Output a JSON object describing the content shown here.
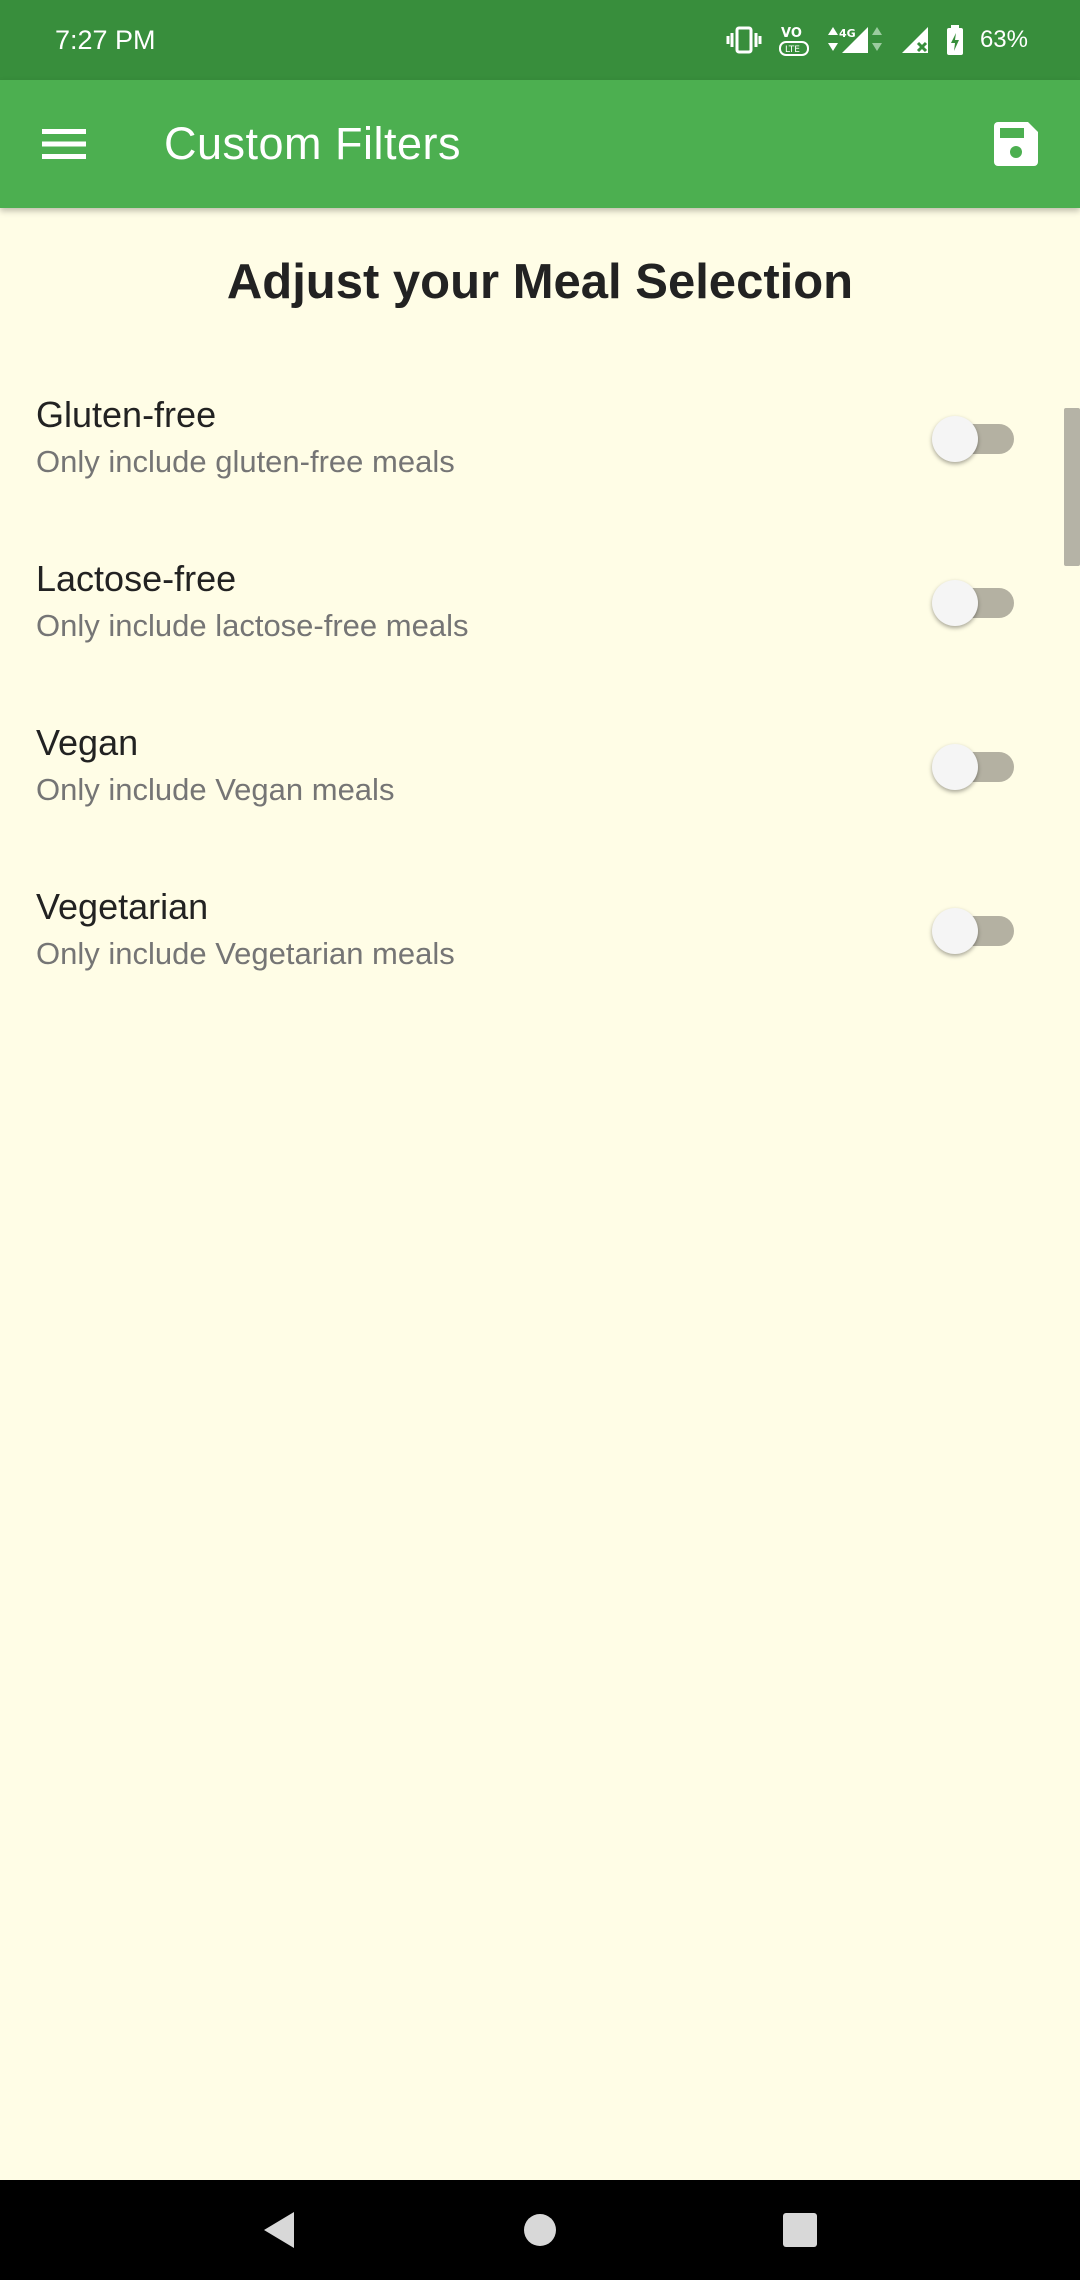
{
  "status_bar": {
    "time": "7:27 PM",
    "battery": "63%",
    "network": "4G",
    "icons": [
      "vibrate-icon",
      "volte-icon",
      "signal-icon",
      "signal-no-data-icon",
      "battery-charging-icon"
    ]
  },
  "app_bar": {
    "title": "Custom Filters",
    "menu_icon": "menu-icon",
    "save_icon": "save-icon"
  },
  "main": {
    "heading": "Adjust your Meal Selection",
    "filters": [
      {
        "title": "Gluten-free",
        "description": "Only include gluten-free meals",
        "enabled": false
      },
      {
        "title": "Lactose-free",
        "description": "Only include lactose-free meals",
        "enabled": false
      },
      {
        "title": "Vegan",
        "description": "Only include Vegan meals",
        "enabled": false
      },
      {
        "title": "Vegetarian",
        "description": "Only include Vegetarian meals",
        "enabled": false
      }
    ]
  },
  "nav_bar": {
    "icons": [
      "back-icon",
      "home-icon",
      "recents-icon"
    ]
  },
  "colors": {
    "status_bar": "#388e3c",
    "app_bar": "#4caf50",
    "background": "#fffde6",
    "switch_track_off": "#b4b1a2",
    "switch_thumb_off": "#f5f5f5"
  }
}
